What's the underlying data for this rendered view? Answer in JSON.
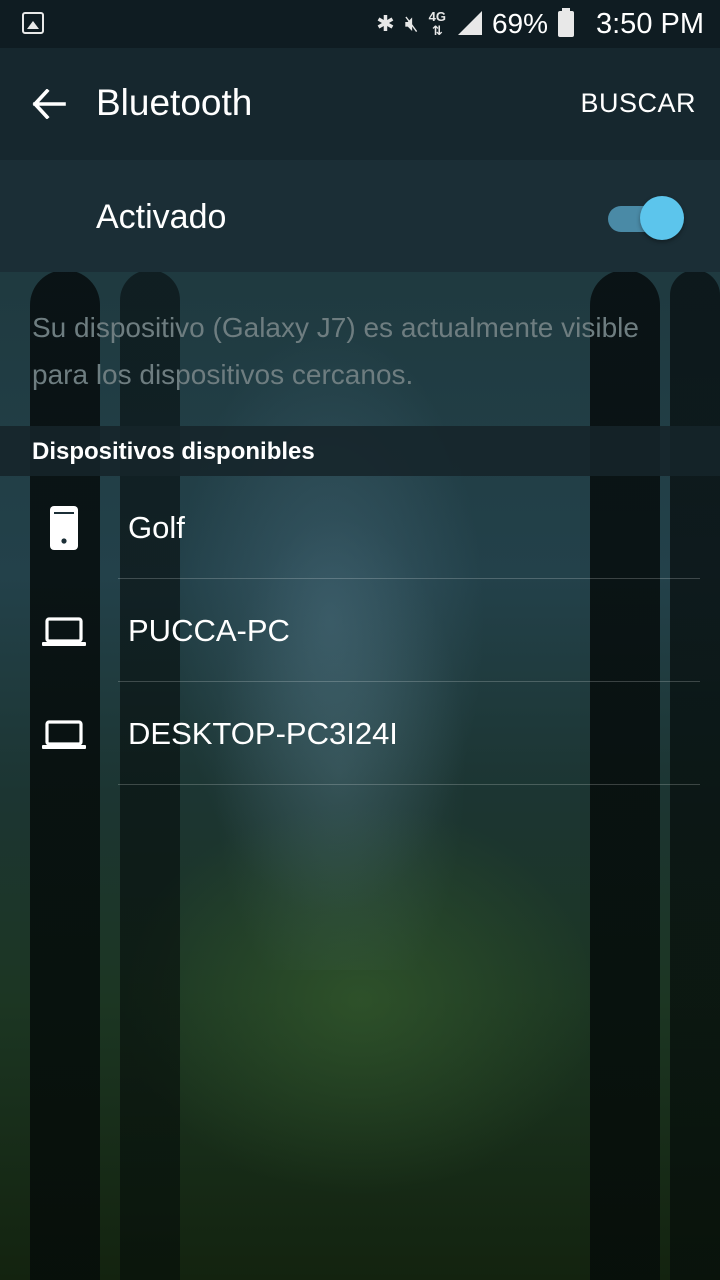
{
  "status_bar": {
    "battery": "69%",
    "time": "3:50 PM",
    "network": "4G",
    "left_icon": "image-notification-icon",
    "icons": [
      "bluetooth-icon",
      "mute-icon",
      "4g-icon",
      "signal-icon",
      "battery-icon"
    ]
  },
  "toolbar": {
    "title": "Bluetooth",
    "search_label": "BUSCAR",
    "back_icon": "arrow-left-icon"
  },
  "toggle": {
    "label": "Activado",
    "state": true,
    "accent": "#5cc5ec"
  },
  "visibility_text": "Su dispositivo (Galaxy J7) es actualmente visible para los dispositivos cercanos.",
  "section_header": "Dispositivos disponibles",
  "devices": [
    {
      "name": "Golf",
      "icon": "phone-icon"
    },
    {
      "name": "PUCCA-PC",
      "icon": "laptop-icon"
    },
    {
      "name": "DESKTOP-PC3I24I",
      "icon": "laptop-icon"
    }
  ]
}
